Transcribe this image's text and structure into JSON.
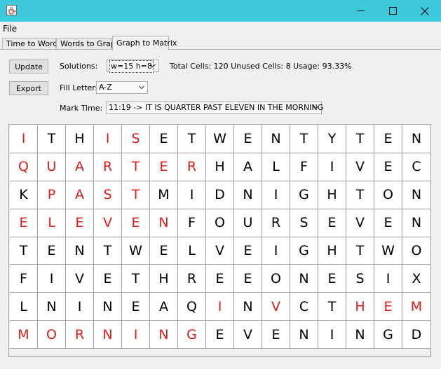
{
  "window": {
    "app_icon": "java-cup-icon",
    "buttons": [
      "minimize-icon",
      "maximize-icon",
      "close-icon"
    ]
  },
  "menu": {
    "file": "File"
  },
  "tabs": [
    {
      "label": "Time to Words",
      "active": false
    },
    {
      "label": "Words to Graph",
      "active": false
    },
    {
      "label": "Graph to Matrix",
      "active": true
    }
  ],
  "controls": {
    "update_label": "Update",
    "export_label": "Export",
    "solutions_label": "Solutions:",
    "solutions_value": "w=15 h=8",
    "stats": "Total Cells: 120 Unused Cells: 8 Usage: 93.33%",
    "fill_letters_label": "Fill Letters:",
    "fill_letters_value": "A-Z",
    "mark_time_label": "Mark Time:",
    "mark_time_value": "11:19 -> IT IS QUARTER PAST ELEVEN IN THE MORNING"
  },
  "matrix": {
    "columns": 15,
    "rows": 8,
    "highlight_color": "#e01b1b",
    "letters": [
      "ITHISETWENTYTEN",
      "QUARTERHALFIVEC",
      "KPASTMIDNIGHTON",
      "ELEVENFOURSEVEN",
      "TENTWELVEIGHTWO",
      "FIVETHREEONESIX",
      "LNINEAQINVCTHEM",
      "MORNINGEVENINGD"
    ],
    "marked": [
      "100110000000000",
      "111111100000000",
      "011110000000000",
      "111111000000000",
      "000000000000000",
      "000000000000000",
      "000000010100111",
      "111111100000000"
    ]
  }
}
